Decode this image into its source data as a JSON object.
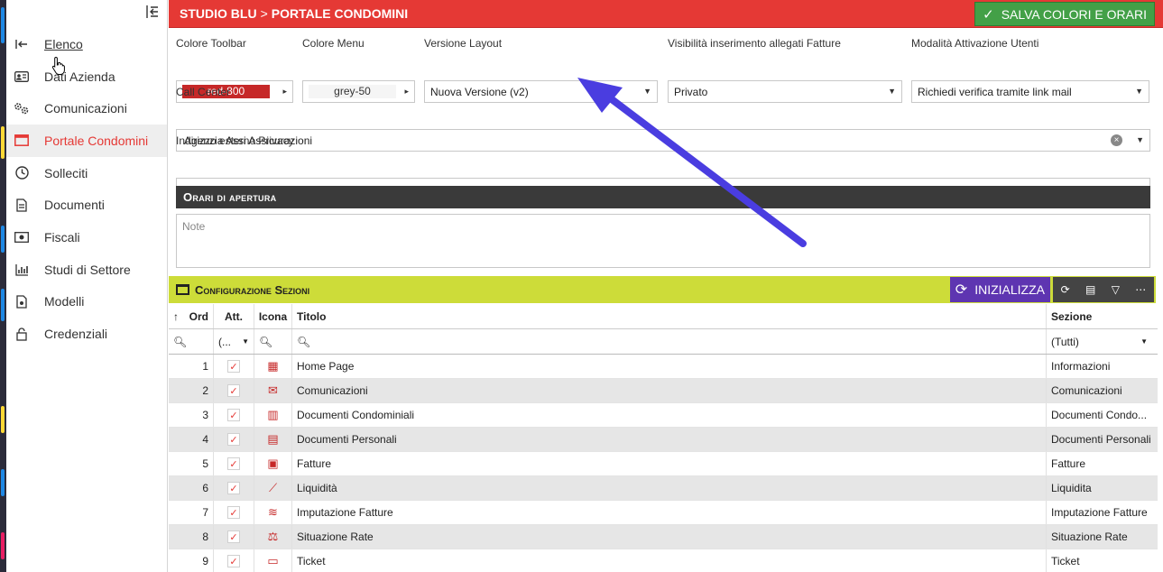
{
  "colors": {
    "topbar": "#e53935",
    "save_button": "#43a047",
    "init_button": "#5e35b1",
    "lime_section": "#cddc39",
    "dark_section": "#3a3a3a",
    "red_swatch": "#c62828",
    "grey_swatch": "#fafafa",
    "annotation_arrow": "#4a3de0"
  },
  "sidebar": {
    "collapse_icon": "collapse-left-icon",
    "items": [
      {
        "label": "Elenco",
        "icon": "exit-arrow-icon"
      },
      {
        "label": "Dati Azienda",
        "icon": "id-card-icon"
      },
      {
        "label": "Comunicazioni",
        "icon": "gears-icon"
      },
      {
        "label": "Portale Condomini",
        "icon": "browser-window-icon"
      },
      {
        "label": "Solleciti",
        "icon": "clock-icon"
      },
      {
        "label": "Documenti",
        "icon": "document-icon"
      },
      {
        "label": "Fiscali",
        "icon": "money-icon"
      },
      {
        "label": "Studi di Settore",
        "icon": "bar-chart-icon"
      },
      {
        "label": "Modelli",
        "icon": "file-icon"
      },
      {
        "label": "Credenziali",
        "icon": "lock-icon"
      }
    ]
  },
  "header": {
    "crumb_1": "STUDIO BLU",
    "separator": ">",
    "crumb_2": "PORTALE CONDOMINI",
    "save_label": "SALVA COLORI E ORARI"
  },
  "form": {
    "colore_toolbar": {
      "label": "Colore Toolbar",
      "value": "red-800"
    },
    "colore_menu": {
      "label": "Colore Menu",
      "value": "grey-50"
    },
    "versione_layout": {
      "label": "Versione Layout",
      "value": "Nuova Versione (v2)"
    },
    "visibilita": {
      "label": "Visibilità inserimento allegati Fatture",
      "value": "Privato"
    },
    "modalita": {
      "label": "Modalità Attivazione Utenti",
      "value": "Richiedi verifica tramite link mail"
    },
    "call_center": {
      "label": "Call Center",
      "value": "Agenzia Assi Assicurazioni"
    },
    "privacy": {
      "label": "Indirizzo esterno Privacy",
      "value": ""
    }
  },
  "orari": {
    "title": "Orari di apertura",
    "note_placeholder": "Note"
  },
  "config": {
    "title": "Configurazione Sezioni",
    "init_label": "INIZIALIZZA",
    "columns": {
      "ord": "Ord",
      "att": "Att.",
      "icona": "Icona",
      "titolo": "Titolo",
      "sezione": "Sezione"
    },
    "filters": {
      "att": "(...",
      "sezione": "(Tutti)"
    },
    "rows": [
      {
        "ord": "1",
        "icon": "grid-icon",
        "icon_glyph": "▦",
        "titolo": "Home Page",
        "sezione": "Informazioni"
      },
      {
        "ord": "2",
        "icon": "envelope-open-icon",
        "icon_glyph": "✉",
        "titolo": "Comunicazioni",
        "sezione": "Comunicazioni"
      },
      {
        "ord": "3",
        "icon": "books-icon",
        "icon_glyph": "▥",
        "titolo": "Documenti Condominiali",
        "sezione": "Documenti Condo..."
      },
      {
        "ord": "4",
        "icon": "id-card-icon",
        "icon_glyph": "▤",
        "titolo": "Documenti Personali",
        "sezione": "Documenti Personali"
      },
      {
        "ord": "5",
        "icon": "receipt-icon",
        "icon_glyph": "▣",
        "titolo": "Fatture",
        "sezione": "Fatture"
      },
      {
        "ord": "6",
        "icon": "line-chart-icon",
        "icon_glyph": "⟋",
        "titolo": "Liquidità",
        "sezione": "Liquidita"
      },
      {
        "ord": "7",
        "icon": "area-chart-icon",
        "icon_glyph": "≋",
        "titolo": "Imputazione Fatture",
        "sezione": "Imputazione Fatture"
      },
      {
        "ord": "8",
        "icon": "scale-icon",
        "icon_glyph": "⚖",
        "titolo": "Situazione Rate",
        "sezione": "Situazione Rate"
      },
      {
        "ord": "9",
        "icon": "ticket-icon",
        "icon_glyph": "▭",
        "titolo": "Ticket",
        "sezione": "Ticket"
      }
    ]
  }
}
